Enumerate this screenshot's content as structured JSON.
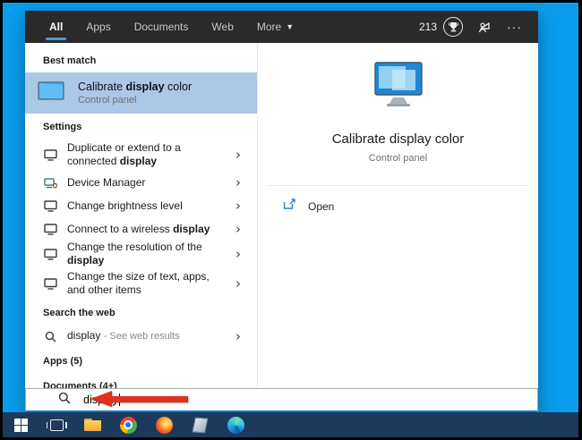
{
  "colors": {
    "desktop_blue": "#0a9ded",
    "taskbar_navy": "#1b3a5c",
    "header_dark": "#2a2a2a",
    "accent_blue": "#0078d7",
    "best_match_highlight": "#abc8e6",
    "annotation_arrow_red": "#e0301e"
  },
  "header": {
    "tabs": [
      {
        "label": "All"
      },
      {
        "label": "Apps"
      },
      {
        "label": "Documents"
      },
      {
        "label": "Web"
      }
    ],
    "more": {
      "label": "More",
      "caret": "▼"
    },
    "rewards_count": "213",
    "more_options": "···"
  },
  "left": {
    "best_match": {
      "header": "Best match",
      "item": {
        "pre": "Calibrate ",
        "bold": "display",
        "post": " color",
        "subtitle": "Control panel"
      }
    },
    "settings": {
      "header": "Settings",
      "items": [
        {
          "pre": "Duplicate or extend to a connected ",
          "bold": "display",
          "post": ""
        },
        {
          "pre": "Device Manager",
          "bold": "",
          "post": ""
        },
        {
          "pre": "Change brightness level",
          "bold": "",
          "post": ""
        },
        {
          "pre": "Connect to a wireless ",
          "bold": "display",
          "post": ""
        },
        {
          "pre": "Change the resolution of the ",
          "bold": "display",
          "post": ""
        },
        {
          "pre": "Change the size of text, apps, and other items",
          "bold": "",
          "post": ""
        }
      ]
    },
    "web": {
      "header": "Search the web",
      "item": {
        "query": "display",
        "suffix": "- See web results"
      }
    },
    "apps_header": "Apps (5)",
    "documents_header": "Documents (4+)"
  },
  "right": {
    "title": "Calibrate display color",
    "subtitle": "Control panel",
    "open_label": "Open"
  },
  "search": {
    "query": "display"
  },
  "glyphs": {
    "chevron": "›"
  },
  "taskbar": {
    "icons": [
      "start",
      "task-view",
      "file-explorer",
      "chrome",
      "firefox",
      "notepad",
      "edge"
    ]
  }
}
